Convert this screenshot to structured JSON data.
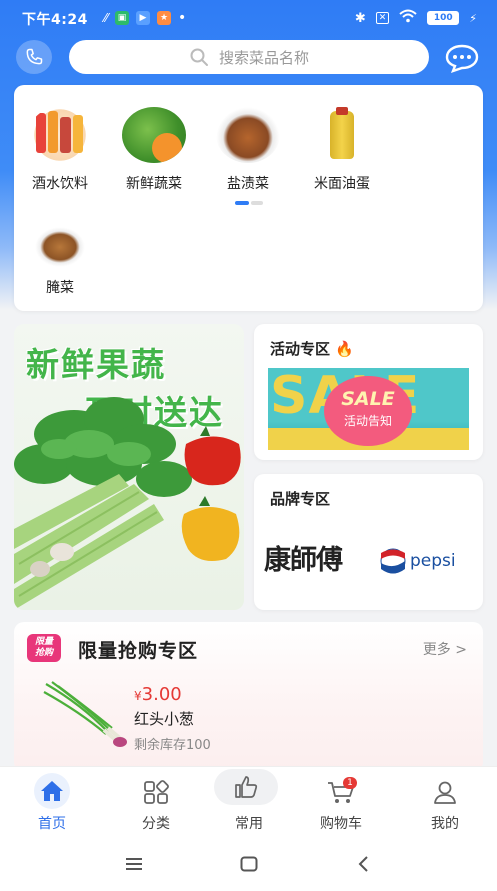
{
  "status_bar": {
    "time": "下午4:24",
    "network_speed": "",
    "battery": "100"
  },
  "search": {
    "placeholder": "搜索菜品名称"
  },
  "categories": [
    {
      "label": "酒水饮料",
      "icon": "drinks-image"
    },
    {
      "label": "新鲜蔬菜",
      "icon": "vegetables-image"
    },
    {
      "label": "盐渍菜",
      "icon": "salted-veg-image"
    },
    {
      "label": "米面油蛋",
      "icon": "rice-oil-image"
    },
    {
      "label": "腌菜",
      "icon": "pickles-image"
    }
  ],
  "promo": {
    "banner_line1": "新鲜果蔬",
    "banner_line2": "及时送达",
    "activity_title": "活动专区",
    "sale_text": "SALE",
    "sale_sub": "活动告知",
    "brand_title": "品牌专区",
    "brand1": "康師傅",
    "brand2": "pepsi"
  },
  "flash_sale": {
    "badge_line1": "限量",
    "badge_line2": "抢购",
    "title": "限量抢购专区",
    "more": "更多",
    "item": {
      "currency": "¥",
      "price": "3.00",
      "name": "红头小葱",
      "stock": "剩余库存100"
    }
  },
  "tabs": [
    {
      "label": "首页",
      "icon": "home-icon",
      "active": true
    },
    {
      "label": "分类",
      "icon": "category-icon"
    },
    {
      "label": "常用",
      "icon": "thumbs-up-icon"
    },
    {
      "label": "购物车",
      "icon": "cart-icon",
      "badge": "1"
    },
    {
      "label": "我的",
      "icon": "profile-icon"
    }
  ],
  "colors": {
    "primary": "#2f7cf5",
    "accent": "#e53935",
    "green": "#43b54a"
  }
}
